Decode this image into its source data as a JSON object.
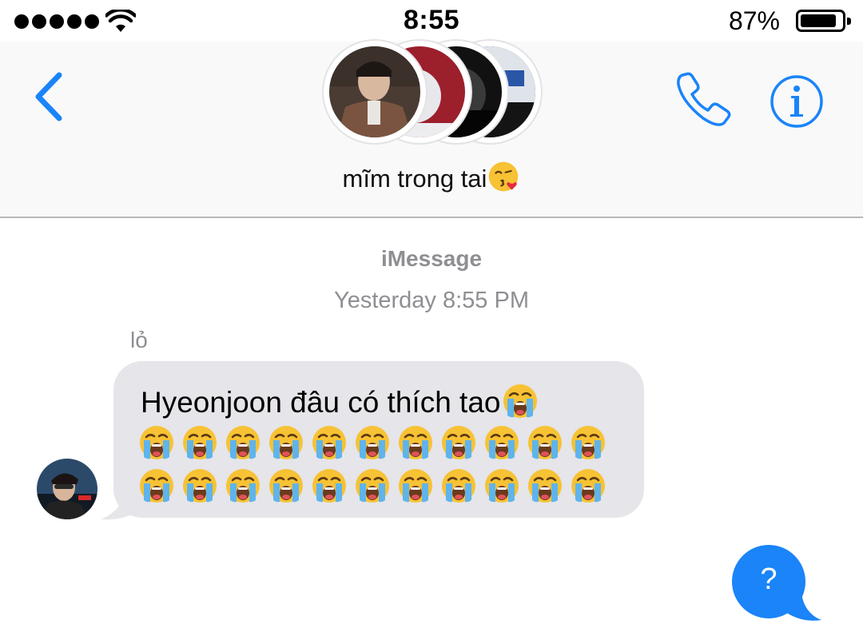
{
  "status_bar": {
    "time": "8:55",
    "battery_percent": "87%",
    "battery_level": 0.87,
    "signal_bars": 5,
    "icons": [
      "signal-dots-icon",
      "wifi-icon",
      "battery-icon"
    ]
  },
  "header": {
    "group_name": "mĩm trong tai",
    "group_name_emoji": "face-blowing-kiss",
    "icons": [
      "back-chevron-icon",
      "phone-icon",
      "info-icon"
    ],
    "accent_color": "#1a84f8"
  },
  "conversation": {
    "service_label": "iMessage",
    "timestamp": "Yesterday 8:55 PM",
    "incoming": {
      "sender": "lỏ",
      "text": "Hyeonjoon đâu có thích tao",
      "trailing_emoji": "loudly-crying-face",
      "emoji_rows": 2,
      "emoji_per_row": 11
    },
    "outgoing": {
      "text": "?"
    }
  }
}
